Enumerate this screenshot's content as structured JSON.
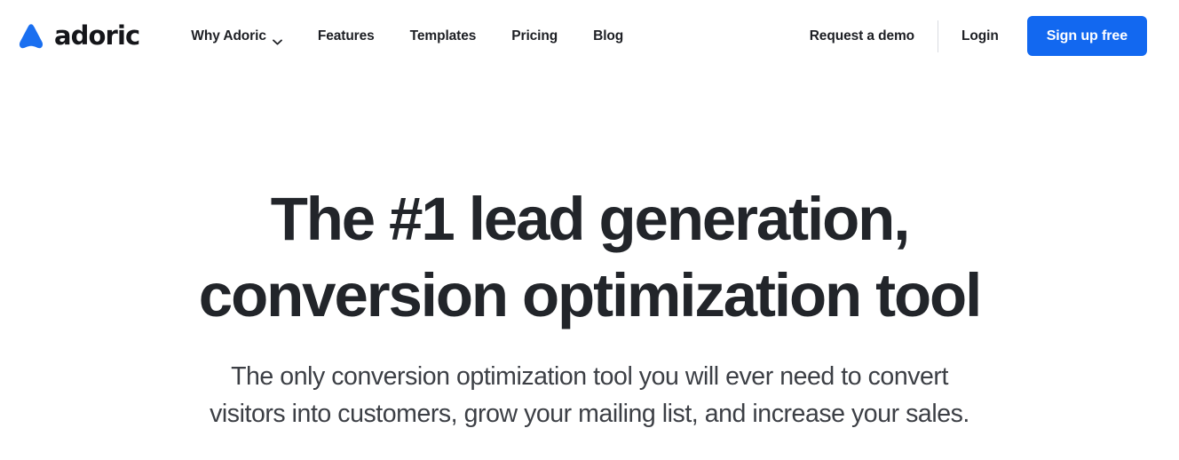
{
  "brand": {
    "name": "adoric",
    "logo_icon": "adoric-triangle-logo",
    "logo_color": "#1a6ff0",
    "wordmark_color": "#15161a"
  },
  "header": {
    "nav": [
      {
        "label": "Why Adoric",
        "has_dropdown": true,
        "icon": "chevron-down-icon"
      },
      {
        "label": "Features",
        "has_dropdown": false
      },
      {
        "label": "Templates",
        "has_dropdown": false
      },
      {
        "label": "Pricing",
        "has_dropdown": false
      },
      {
        "label": "Blog",
        "has_dropdown": false
      }
    ],
    "actions": {
      "request_demo_label": "Request a demo",
      "login_label": "Login",
      "signup_label": "Sign up free",
      "signup_color": "#1268f0",
      "divider_color": "#d9dce1"
    }
  },
  "hero": {
    "title_lines": [
      "The #1 lead generation,",
      "conversion optimization tool"
    ],
    "title_color": "#22252a",
    "subtitle_lines": [
      "The only conversion optimization tool you will ever need to convert",
      "visitors into customers, grow your mailing list, and increase your sales."
    ],
    "subtitle_color": "#3c3f45"
  },
  "page": {
    "background": "#ffffff"
  }
}
